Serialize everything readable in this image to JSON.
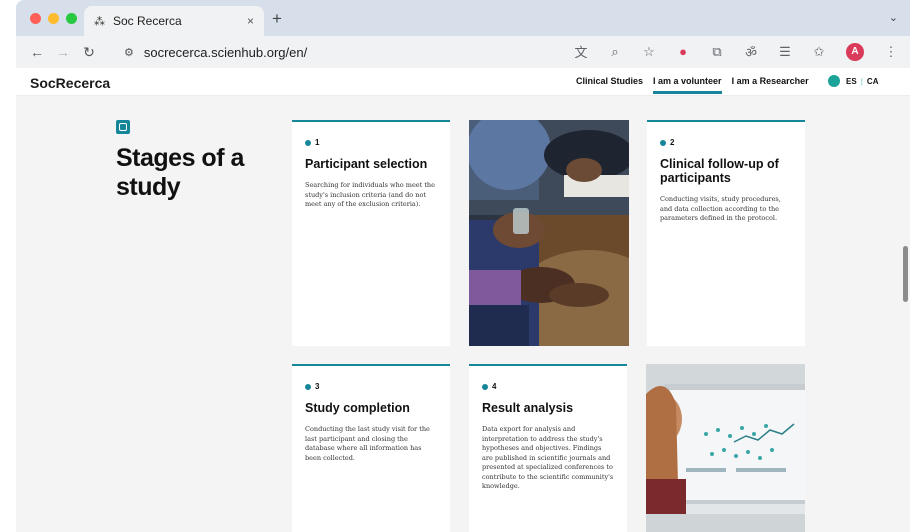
{
  "browser": {
    "tab_title": "Soc Recerca",
    "tab_close": "×",
    "new_tab": "+",
    "tab_menu": "⌄",
    "url": "socrecerca.scienhub.org/en/",
    "avatar_letter": "A"
  },
  "site": {
    "logo": "SocRecerca",
    "nav": [
      "Clinical Studies",
      "I am a volunteer",
      "I am a Researcher"
    ],
    "active_nav": "I am a volunteer",
    "lang_es": "ES",
    "lang_sep": "|",
    "lang_ca": "CA"
  },
  "section": {
    "title": "Stages of a study"
  },
  "stages": [
    {
      "number": "1",
      "title": "Participant selection",
      "body": "Searching for individuals who meet the study's inclusion criteria (and do not meet any of the exclusion criteria)."
    },
    {
      "number": "2",
      "title": "Clinical follow-up of participants",
      "body": "Conducting visits, study procedures, and data collection according to the parameters defined in the protocol."
    },
    {
      "number": "3",
      "title": "Study completion",
      "body": "Conducting the last study visit for the last participant and closing the database where all information has been collected."
    },
    {
      "number": "4",
      "title": "Result analysis",
      "body": "Data export for analysis and interpretation to address the study's hypotheses and objectives. Findings are published in scientific journals and presented at specialized conferences to contribute to the scientific community's knowledge."
    }
  ],
  "colors": {
    "accent": "#16869a",
    "tabstrip": "#d7e0ea",
    "page_bg": "#f4f4f4"
  },
  "icons": {
    "back": "arrow-left-icon",
    "forward": "arrow-right-icon",
    "reload": "reload-icon",
    "site_settings": "tune-icon",
    "translate": "translate-icon",
    "zoom": "zoom-icon",
    "bookmark": "star-icon",
    "language": "globe-icon"
  }
}
